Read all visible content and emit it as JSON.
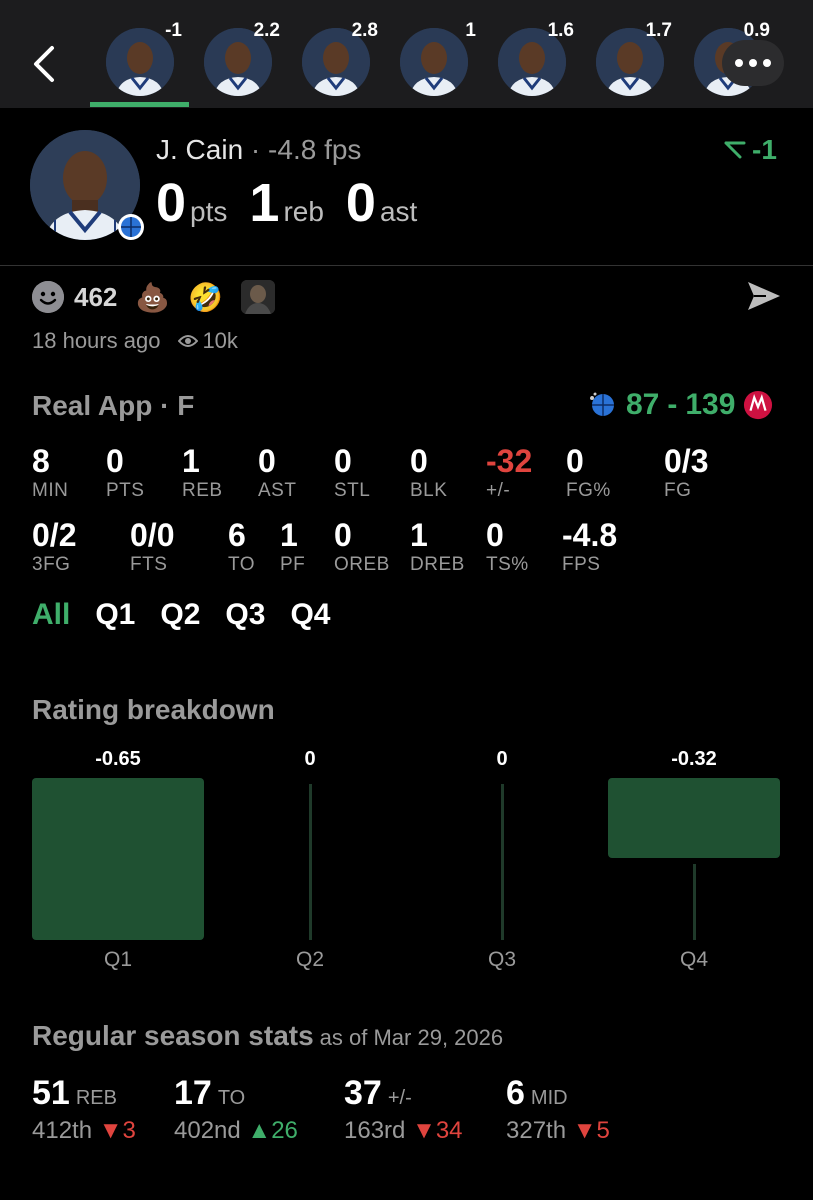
{
  "nav": {
    "avatars": [
      {
        "value": "-1",
        "active": true
      },
      {
        "value": "2.2"
      },
      {
        "value": "2.8"
      },
      {
        "value": "1"
      },
      {
        "value": "1.6"
      },
      {
        "value": "1.7"
      },
      {
        "value": "0.9"
      }
    ]
  },
  "player": {
    "name": "J. Cain",
    "fps_text": "-4.8 fps",
    "trend_value": "-1",
    "pts": "0",
    "pts_label": "pts",
    "reb": "1",
    "reb_label": "reb",
    "ast": "0",
    "ast_label": "ast"
  },
  "social": {
    "reaction_count": "462",
    "emojis": [
      "💩",
      "🤣"
    ],
    "time_ago": "18 hours ago",
    "views": "10k"
  },
  "game": {
    "title": "Real App · F",
    "score_home": "87",
    "score_sep": "-",
    "score_away": "139",
    "colors": {
      "positive": "#3fae6a",
      "negative": "#e0443e"
    }
  },
  "stats_row1": [
    {
      "value": "8",
      "label": "MIN"
    },
    {
      "value": "0",
      "label": "PTS"
    },
    {
      "value": "1",
      "label": "REB"
    },
    {
      "value": "0",
      "label": "AST"
    },
    {
      "value": "0",
      "label": "STL"
    },
    {
      "value": "0",
      "label": "BLK"
    },
    {
      "value": "-32",
      "label": "+/-"
    },
    {
      "value": "0",
      "label": "FG%"
    },
    {
      "value": "0/3",
      "label": "FG"
    }
  ],
  "stats_row2": [
    {
      "value": "0/2",
      "label": "3FG"
    },
    {
      "value": "0/0",
      "label": "FTS"
    },
    {
      "value": "6",
      "label": "TO"
    },
    {
      "value": "1",
      "label": "PF"
    },
    {
      "value": "0",
      "label": "OREB"
    },
    {
      "value": "1",
      "label": "DREB"
    },
    {
      "value": "0",
      "label": "TS%"
    },
    {
      "value": "-4.8",
      "label": "FPS"
    }
  ],
  "quarter_tabs": [
    "All",
    "Q1",
    "Q2",
    "Q3",
    "Q4"
  ],
  "rating": {
    "title": "Rating breakdown",
    "chart_data": {
      "type": "bar",
      "categories": [
        "Q1",
        "Q2",
        "Q3",
        "Q4"
      ],
      "values": [
        -0.65,
        0,
        0,
        -0.32
      ],
      "labels": [
        "-0.65",
        "0",
        "0",
        "-0.32"
      ]
    }
  },
  "season": {
    "title": "Regular season stats",
    "as_of": "as of Mar 29, 2026",
    "items": [
      {
        "value": "51",
        "unit": "REB",
        "rank": "412th",
        "dir": "down",
        "change": "3"
      },
      {
        "value": "17",
        "unit": "TO",
        "rank": "402nd",
        "dir": "up",
        "change": "26"
      },
      {
        "value": "37",
        "unit": "+/-",
        "rank": "163rd",
        "dir": "down",
        "change": "34"
      },
      {
        "value": "6",
        "unit": "MID",
        "rank": "327th",
        "dir": "down",
        "change": "5"
      }
    ]
  }
}
